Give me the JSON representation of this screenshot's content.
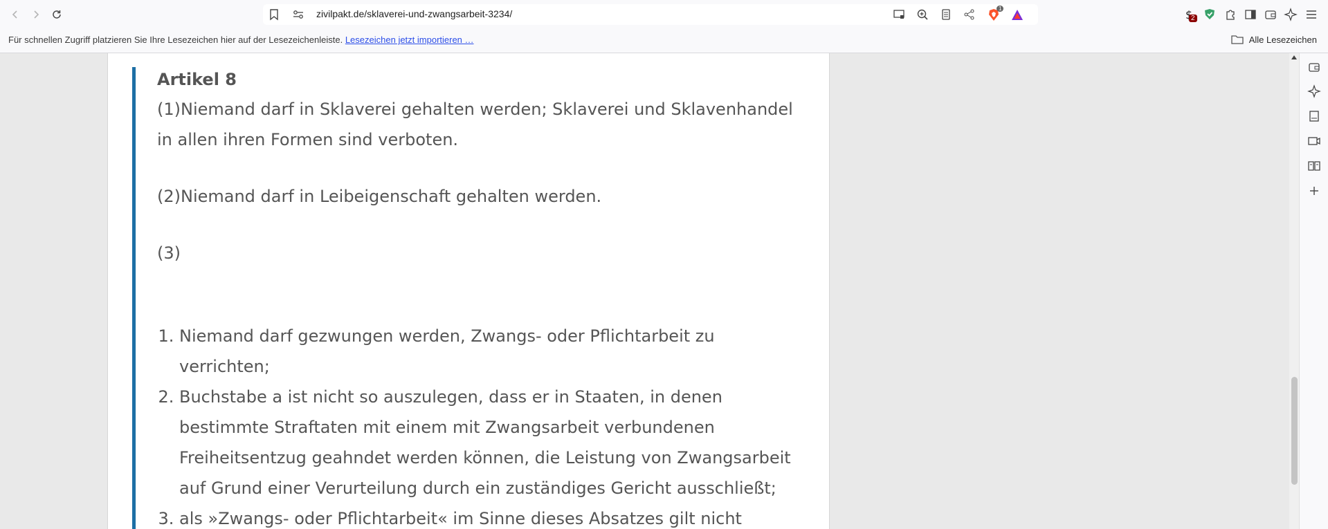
{
  "browser": {
    "url": "zivilpakt.de/sklaverei-und-zwangsarbeit-3234/",
    "extension_badges": {
      "shields_count": "1",
      "wallet_count": "2"
    }
  },
  "bookmarks_bar": {
    "hint": "Für schnellen Zugriff platzieren Sie Ihre Lesezeichen hier auf der Lesezeichenleiste.",
    "import_link": "Lesezeichen jetzt importieren …",
    "all_bookmarks": "Alle Lesezeichen"
  },
  "article": {
    "heading": "Artikel 8",
    "paragraph_1": "(1)Niemand darf in Sklaverei gehalten werden; Sklaverei und Sklavenhandel in allen ihren Formen sind verboten.",
    "paragraph_2": "(2)Niemand darf in Leibeigenschaft gehalten werden.",
    "paragraph_3": "(3)",
    "list_items": [
      "Niemand darf gezwungen werden, Zwangs- oder Pflichtarbeit zu verrichten;",
      "Buchstabe a ist nicht so auszulegen, dass er in Staaten, in denen bestimmte Straftaten mit einem mit Zwangsarbeit verbundenen Freiheitsentzug geahndet werden können, die Leistung von Zwangsarbeit auf Grund einer Verurteilung durch ein zuständiges Gericht ausschließt;",
      "als »Zwangs- oder Pflichtarbeit« im Sinne dieses Absatzes gilt nicht"
    ]
  },
  "colors": {
    "accent_bar": "#1d6fa5",
    "link": "#2c4ee8",
    "text": "#555555",
    "page_background": "#e9e9e9"
  },
  "icons": {
    "toolbar": [
      "back-arrow-icon",
      "forward-arrow-icon",
      "reload-icon",
      "bookmark-icon",
      "site-info-icon",
      "cast-icon",
      "zoom-icon",
      "reader-mode-icon",
      "share-icon",
      "brave-shields-icon",
      "brave-rewards-icon",
      "wallet-icon",
      "vpn-shield-icon",
      "extensions-icon",
      "sidebar-toggle-icon",
      "wallet-panel-icon",
      "leo-ai-icon",
      "menu-icon"
    ],
    "sidebar": [
      "wallet-icon",
      "leo-ai-icon",
      "bookmarks-icon",
      "video-icon",
      "reading-list-icon",
      "add-icon"
    ]
  }
}
